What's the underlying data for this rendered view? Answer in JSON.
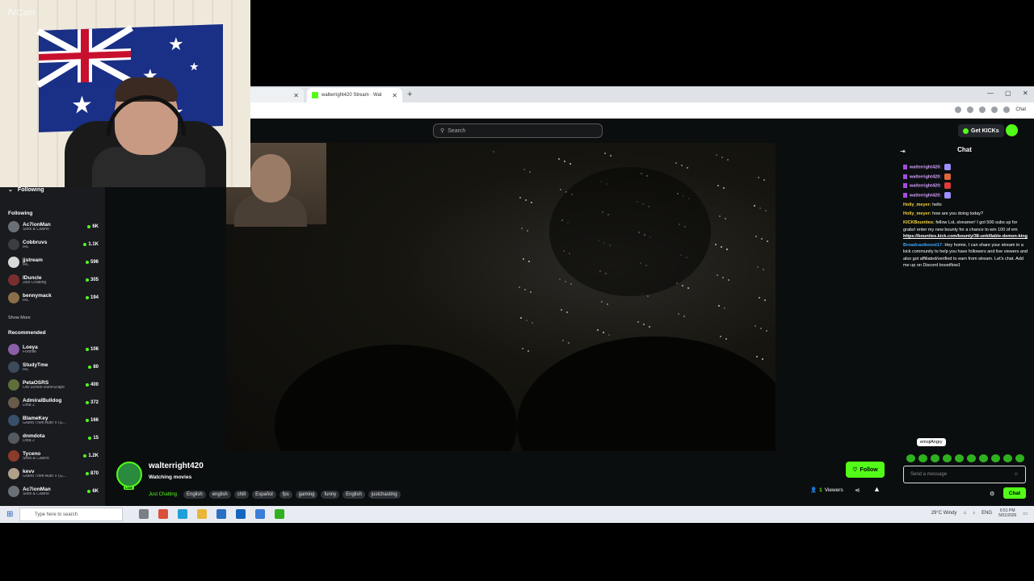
{
  "webcam": {
    "brand": "fVCam"
  },
  "browser": {
    "tabs": [
      {
        "label": "walterright420 Stream · Wat"
      }
    ],
    "new_tab": "+",
    "window_controls": [
      "—",
      "▢",
      "✕"
    ],
    "addr_chat_label": "Chat"
  },
  "header": {
    "search_placeholder": "Search",
    "get_kicks_label": "Get KICKs"
  },
  "sidebar": {
    "following_toggle": "Following",
    "following_heading": "Following",
    "following": [
      {
        "name": "Ac7ionMan",
        "category": "Slots & Casino",
        "viewers": "6K",
        "color": "#6b6f76"
      },
      {
        "name": "Cobbruvs",
        "category": "IRL",
        "viewers": "1.1K",
        "color": "#3a3d42"
      },
      {
        "name": "jjstream",
        "category": "IRL",
        "viewers": "596",
        "color": "#d9d9d9"
      },
      {
        "name": "IDuncle",
        "category": "Just Chatting",
        "viewers": "305",
        "color": "#7a2f2f"
      },
      {
        "name": "bennymack",
        "category": "IRL",
        "viewers": "194",
        "color": "#8a6f4a"
      }
    ],
    "show_more": "Show More",
    "recommended_heading": "Recommended",
    "recommended": [
      {
        "name": "Loeya",
        "category": "Fortnite",
        "viewers": "106",
        "color": "#8a5ea8"
      },
      {
        "name": "StudyTme",
        "category": "IRL",
        "viewers": "80",
        "color": "#3c4a5c"
      },
      {
        "name": "PetaOSRS",
        "category": "Old School RuneScape",
        "viewers": "400",
        "color": "#5f6f3a"
      },
      {
        "name": "AdmiralBulldog",
        "category": "Dota 2",
        "viewers": "372",
        "color": "#6a5a4a"
      },
      {
        "name": "BlameKey",
        "category": "Grand Theft Auto V (G...",
        "viewers": "166",
        "color": "#3a4f6a"
      },
      {
        "name": "dnmdota",
        "category": "Dota 2",
        "viewers": "15",
        "color": "#555a60"
      },
      {
        "name": "Tyceno",
        "category": "Slots & Casino",
        "viewers": "1.2K",
        "color": "#8c3a2a"
      },
      {
        "name": "kevv",
        "category": "Grand Theft Auto V (G...",
        "viewers": "870",
        "color": "#b0a08a"
      },
      {
        "name": "Ac7ionMan",
        "category": "Slots & Casino",
        "viewers": "6K",
        "color": "#6b6f76"
      }
    ]
  },
  "stream": {
    "streamer_name": "walterright420",
    "title": "Watching movies",
    "live_badge": "LIVE",
    "category": "Just Chatting",
    "tags": [
      "English",
      "english",
      "chill",
      "Español",
      "fps",
      "gaming",
      "funny",
      "English",
      "justchasting"
    ],
    "follow_label": "Follow",
    "viewers_count": "1",
    "viewers_label": "Viewers"
  },
  "chat": {
    "title": "Chat",
    "messages": [
      {
        "user": "walterright420:",
        "text": "",
        "user_color": "#d7a0ff",
        "badge": true,
        "emote_color": "#9d8fff"
      },
      {
        "user": "walterright420:",
        "text": "",
        "user_color": "#d7a0ff",
        "badge": true,
        "emote_color": "#e0663a"
      },
      {
        "user": "walterright420:",
        "text": "",
        "user_color": "#d7a0ff",
        "badge": true,
        "emote_color": "#e03a3a"
      },
      {
        "user": "walterright420:",
        "text": "",
        "user_color": "#d7a0ff",
        "badge": true,
        "emote_color": "#9d8fff"
      },
      {
        "user": "Holly_meyer:",
        "text": "hello",
        "user_color": "#f5d33a",
        "badge": false,
        "emote_color": ""
      },
      {
        "user": "Holly_meyer:",
        "text": "how are you doing today?",
        "user_color": "#f5d33a",
        "badge": false,
        "emote_color": ""
      },
      {
        "user": "KICKBounties:",
        "text": "fellow LoL streamer! I got 500 subs up for grabs! enter my new bounty for a chance to win 100 of em",
        "link": "https://bounties.kick.com/bounty/38-unkillable-demon-king",
        "user_color": "#f5d33a",
        "badge": false,
        "emote_color": ""
      },
      {
        "user": "Broadcastboost17:",
        "text": "Hey homie, I can share your stream in a kick community to help you have followers and live viewers and also got affiliated/verified to earn from stream. Let's chat. Add me up on Discord boostflow1",
        "user_color": "#3ea6ff",
        "badge": false,
        "emote_color": ""
      }
    ],
    "tooltip": "emojiAngry",
    "input_placeholder": "Send a message",
    "send_label": "Chat"
  },
  "taskbar": {
    "search_placeholder": "Type here to search",
    "weather": "29°C  Windy",
    "lang": "ENG",
    "time": "6:51 PM",
    "date": "5/01/2026"
  }
}
